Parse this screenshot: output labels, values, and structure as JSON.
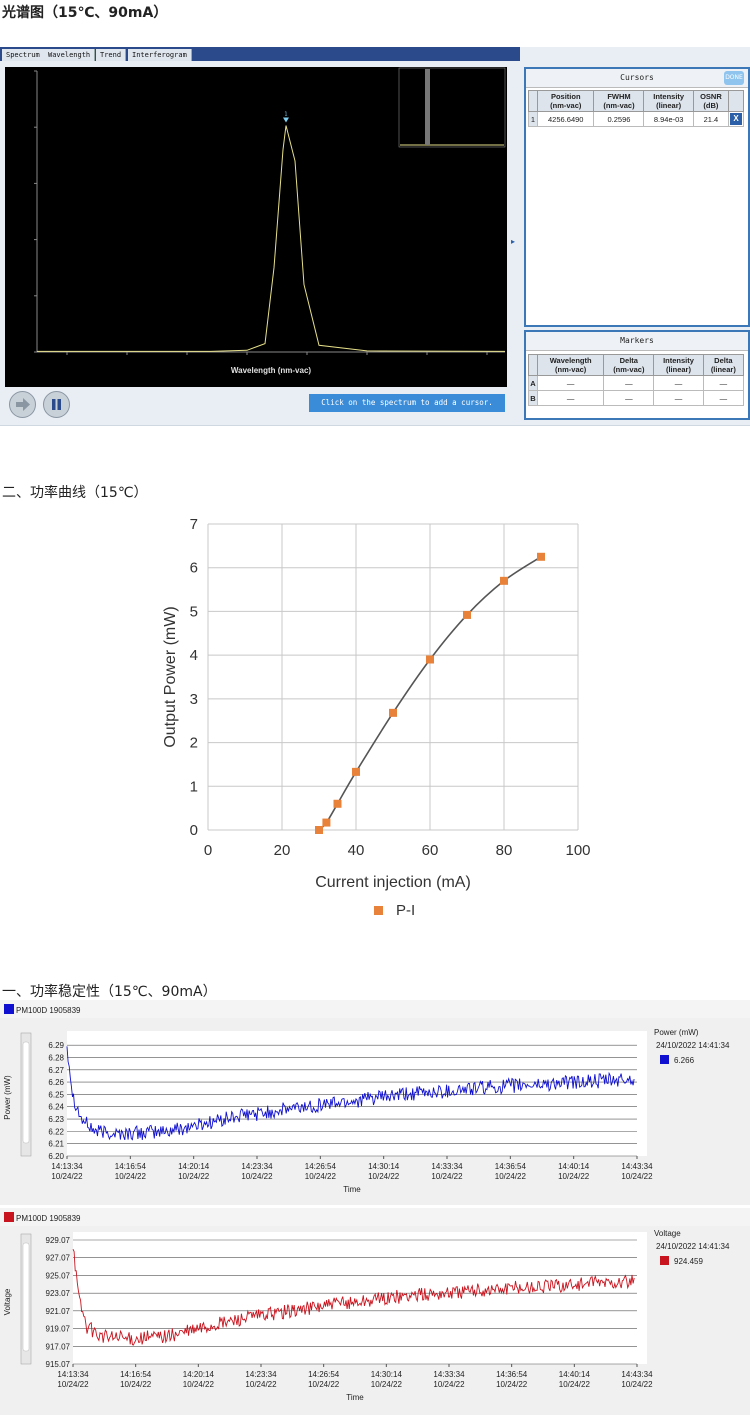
{
  "headings": {
    "spectrum": "光谱图（15℃、90mA）",
    "pi": "二、功率曲线（15℃）",
    "stability": "一、功率稳定性（15℃、90mA）"
  },
  "osa": {
    "tabs": [
      "Spectrum",
      "Wavelength",
      "Trend",
      "Interferogram"
    ],
    "add_cursor_label": "Click on the spectrum to add a cursor.",
    "cursors": {
      "title": "Cursors",
      "done_label": "DONE",
      "headers": [
        [
          "Position",
          "(nm-vac)"
        ],
        [
          "FWHM",
          "(nm-vac)"
        ],
        [
          "Intensity",
          "(linear)"
        ],
        [
          "OSNR",
          "(dB)"
        ]
      ],
      "rows": [
        {
          "idx": "1",
          "position": "4256.6490",
          "fwhm": "0.2596",
          "intensity": "8.94e-03",
          "osnr": "21.4",
          "remove": "X"
        }
      ]
    },
    "markers": {
      "title": "Markers",
      "headers": [
        [
          "Wavelength",
          "(nm-vac)"
        ],
        [
          "Delta",
          "(nm-vac)"
        ],
        [
          "Intensity",
          "(linear)"
        ],
        [
          "Delta",
          "(linear)"
        ]
      ],
      "rows": [
        {
          "idx": "A",
          "cells": [
            "—",
            "—",
            "—",
            "—"
          ]
        },
        {
          "idx": "B",
          "cells": [
            "—",
            "—",
            "—",
            "—"
          ]
        }
      ]
    }
  },
  "chart_data": [
    {
      "type": "line",
      "title": "",
      "xlabel": "Wavelength (nm-vac)",
      "ylabel": "",
      "xlim": [
        4.2525,
        4.2603
      ],
      "ylim": [
        0,
        0.005
      ],
      "x_ticks": [
        "4.253",
        "4.254",
        "4.255",
        "4.256",
        "4.257",
        "4.258",
        "4.259",
        "4.260"
      ],
      "y_ticks": [
        "0",
        "0.001",
        "0.002",
        "0.003",
        "0.004",
        "0.005"
      ],
      "grid": false,
      "series": [
        {
          "color": "#e6e08a",
          "x": [
            4.2525,
            4.2554,
            4.256,
            4.2563,
            4.25645,
            4.2566,
            4.25665,
            4.2568,
            4.25695,
            4.2572,
            4.258,
            4.2603
          ],
          "y": [
            1e-05,
            1e-05,
            3e-05,
            0.00015,
            0.0015,
            0.0036,
            0.00403,
            0.0034,
            0.0012,
            0.00012,
            2e-05,
            1e-05
          ]
        }
      ],
      "cursor_marker": "1"
    },
    {
      "type": "scatter",
      "title": "",
      "xlabel": "Current injection (mA)",
      "ylabel": "Output Power (mW)",
      "xlim": [
        0,
        100
      ],
      "ylim": [
        0,
        7
      ],
      "x_ticks": [
        "0",
        "20",
        "40",
        "60",
        "80",
        "100"
      ],
      "y_ticks": [
        "0",
        "1",
        "2",
        "3",
        "4",
        "5",
        "6",
        "7"
      ],
      "grid": true,
      "legend_position": "bottom",
      "series": [
        {
          "name": "P-I",
          "color": "#e8823a",
          "x": [
            30,
            32,
            35,
            40,
            50,
            60,
            70,
            80,
            90
          ],
          "y": [
            0.0,
            0.17,
            0.6,
            1.33,
            2.68,
            3.9,
            4.92,
            5.7,
            6.25
          ]
        }
      ],
      "fit_line_color": "#555555"
    },
    {
      "type": "line",
      "title": "PM100D 1905839",
      "xlabel": "Time",
      "ylabel": "Power (mW)",
      "ylim": [
        6.2,
        6.295
      ],
      "y_ticks": [
        "6.29",
        "6.28",
        "6.27",
        "6.26",
        "6.25",
        "6.24",
        "6.23",
        "6.22",
        "6.21",
        "6.20"
      ],
      "x_ticks": [
        "14:13:34\n10/24/22",
        "14:16:54\n10/24/22",
        "14:20:14\n10/24/22",
        "14:23:34\n10/24/22",
        "14:26:54\n10/24/22",
        "14:30:14\n10/24/22",
        "14:33:34\n10/24/22",
        "14:36:54\n10/24/22",
        "14:40:14\n10/24/22",
        "14:43:34\n10/24/22"
      ],
      "grid": true,
      "legend": {
        "label": "Power (mW)",
        "timestamp": "24/10/2022 14:41:34",
        "value": "6.266",
        "color": "#1010d0"
      },
      "series": [
        {
          "name": "PM100D 1905839",
          "color": "#1010d0",
          "x_min": [
            0,
            2,
            5,
            10,
            20,
            35,
            60,
            90,
            120,
            150,
            180,
            200
          ],
          "y": [
            6.29,
            6.25,
            6.23,
            6.22,
            6.218,
            6.22,
            6.232,
            6.242,
            6.25,
            6.256,
            6.26,
            6.262
          ],
          "noise": 0.006
        }
      ]
    },
    {
      "type": "line",
      "title": "PM100D 1905839",
      "xlabel": "Time",
      "ylabel": "Voltage",
      "ylim": [
        915.07,
        929.07
      ],
      "y_ticks": [
        "929.07",
        "927.07",
        "925.07",
        "923.07",
        "921.07",
        "919.07",
        "917.07",
        "915.07"
      ],
      "x_ticks": [
        "14:13:34\n10/24/22",
        "14:16:54\n10/24/22",
        "14:20:14\n10/24/22",
        "14:23:34\n10/24/22",
        "14:26:54\n10/24/22",
        "14:30:14\n10/24/22",
        "14:33:34\n10/24/22",
        "14:36:54\n10/24/22",
        "14:40:14\n10/24/22",
        "14:43:34\n10/24/22"
      ],
      "grid": true,
      "legend": {
        "label": "Voltage",
        "timestamp": "24/10/2022 14:41:34",
        "value": "924.459",
        "color": "#c8141e"
      },
      "series": [
        {
          "name": "PM100D 1905839",
          "color": "#c8141e",
          "x_min": [
            0,
            2,
            5,
            10,
            20,
            35,
            60,
            90,
            120,
            150,
            180,
            200
          ],
          "y": [
            928.8,
            922.5,
            919.3,
            918.2,
            917.9,
            918.3,
            920.2,
            921.7,
            922.8,
            923.5,
            924.1,
            924.4
          ],
          "noise": 0.8
        }
      ]
    }
  ]
}
